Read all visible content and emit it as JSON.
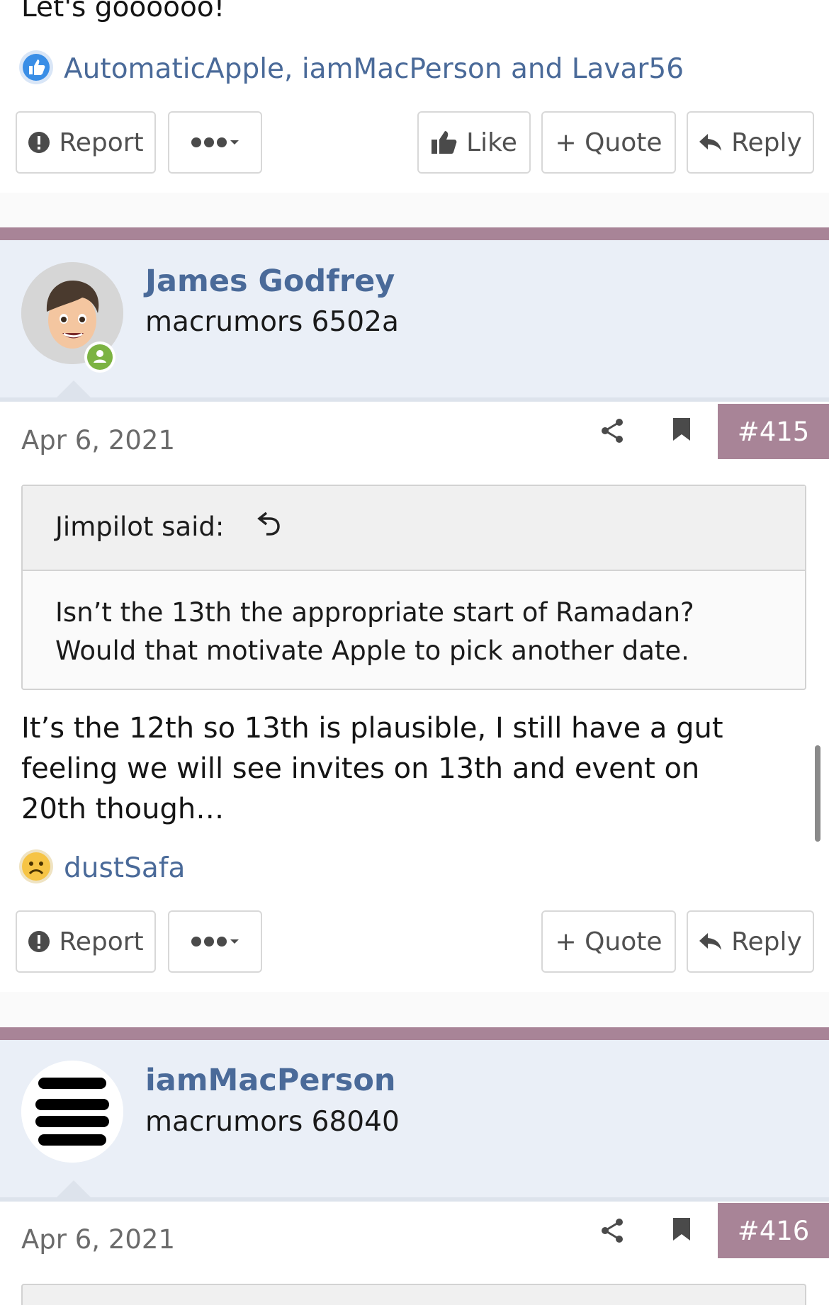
{
  "top_post": {
    "text": "Let's goooooo!",
    "reactions": "AutomaticApple, iamMacPerson and Lavar56",
    "actions": {
      "report": "Report",
      "like": "Like",
      "quote": "+ Quote",
      "reply": "Reply"
    }
  },
  "post_415": {
    "username": "James Godfrey",
    "user_title": "macrumors 6502a",
    "date": "Apr 6, 2021",
    "post_number": "#415",
    "quote_author": "Jimpilot said:",
    "quote_text_line1": "Isn’t the 13th the appropriate start of Ramadan?",
    "quote_text_line2": "Would that motivate Apple to pick another date.",
    "body_line1": "It’s the 12th so 13th is plausible, I still have a gut",
    "body_line2": "feeling we will see invites on 13th and event on",
    "body_line3": "20th though…",
    "reactions": "dustSafa",
    "actions": {
      "report": "Report",
      "quote": "+ Quote",
      "reply": "Reply"
    }
  },
  "post_416": {
    "username": "iamMacPerson",
    "user_title": "macrumors 68040",
    "date": "Apr 6, 2021",
    "post_number": "#416"
  },
  "icons": {
    "like_reaction": "thumbs-up-icon",
    "sad_reaction": "sad-face-icon",
    "report": "exclamation-circle-icon",
    "more": "ellipsis-icon",
    "share": "share-icon",
    "bookmark": "bookmark-icon",
    "reply": "reply-arrow-icon",
    "online": "online-status-icon"
  },
  "colors": {
    "accent": "#a88497",
    "link": "#4a6a99",
    "userbar": "#eaeff7",
    "online": "#7cb342"
  }
}
